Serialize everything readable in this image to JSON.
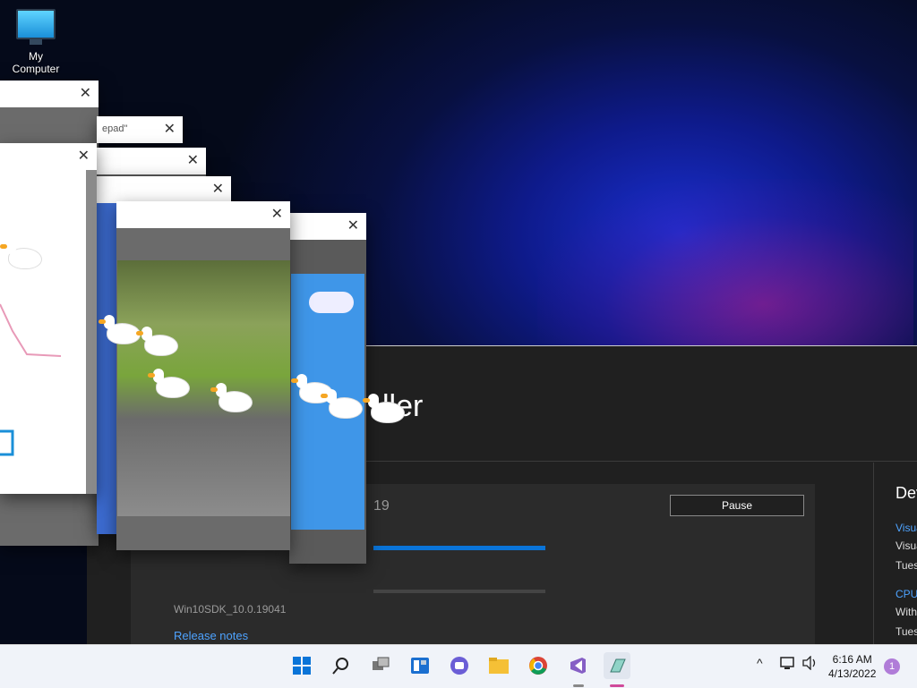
{
  "desktop": {
    "icon_label": "My Computer"
  },
  "installer": {
    "title_partial": "ller",
    "version_partial": "19",
    "pause_label": "Pause",
    "sdk_label": "Win10SDK_10.0.19041",
    "release_notes": "Release notes",
    "right_panel": {
      "heading": "Dev",
      "item1_link": "Visua",
      "item1_line": "Visua",
      "item1_date": "Tues",
      "item2_link": "CPU",
      "item2_line": "With",
      "item2_date": "Tues"
    }
  },
  "windows": {
    "notepad_title_partial": "epad\""
  },
  "taskbar": {
    "icons": [
      "start-icon",
      "search-icon",
      "task-view-icon",
      "widgets-icon",
      "teams-chat-icon",
      "file-explorer-icon",
      "chrome-icon",
      "visual-studio-icon",
      "installer-icon"
    ],
    "time": "6:16 AM",
    "date": "4/13/2022",
    "notification_count": "1"
  }
}
